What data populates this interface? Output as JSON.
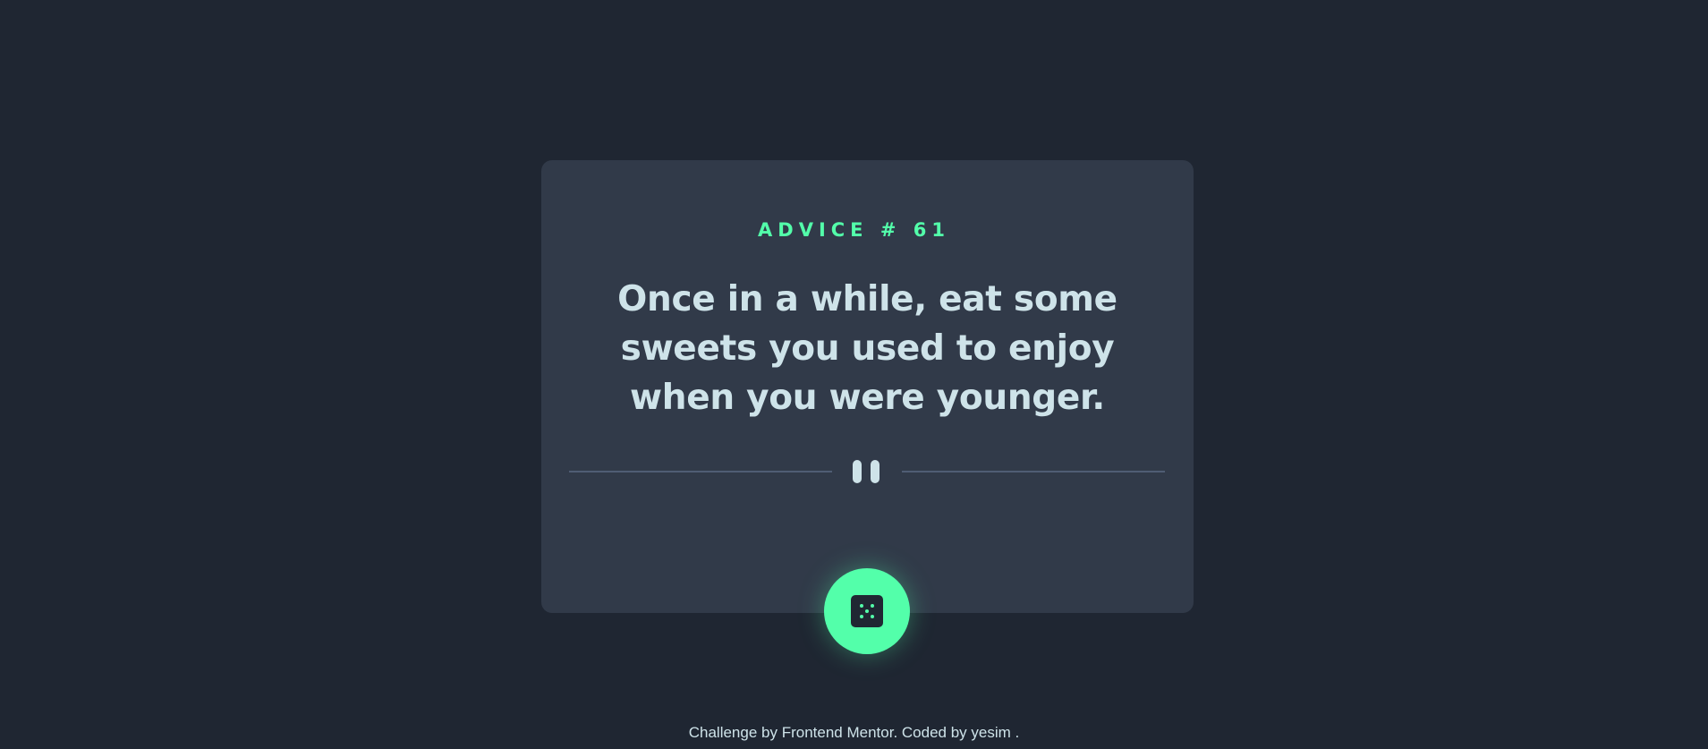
{
  "advice": {
    "id_label": "ADVICE # 61",
    "quote": "Once in a while, eat some sweets you used to enjoy when you were younger."
  },
  "controls": {
    "divider_icon": "pause-icon",
    "dice_icon": "dice-icon"
  },
  "footer": {
    "prefix": "Challenge by ",
    "link1": "Frontend Mentor",
    "middle": ". Coded by ",
    "link2": "yesim",
    "suffix": " ."
  },
  "colors": {
    "background": "#1f2632",
    "card": "#313a49",
    "accent": "#53ffaa",
    "text": "#cee3e9",
    "divider": "#4f5d74"
  }
}
